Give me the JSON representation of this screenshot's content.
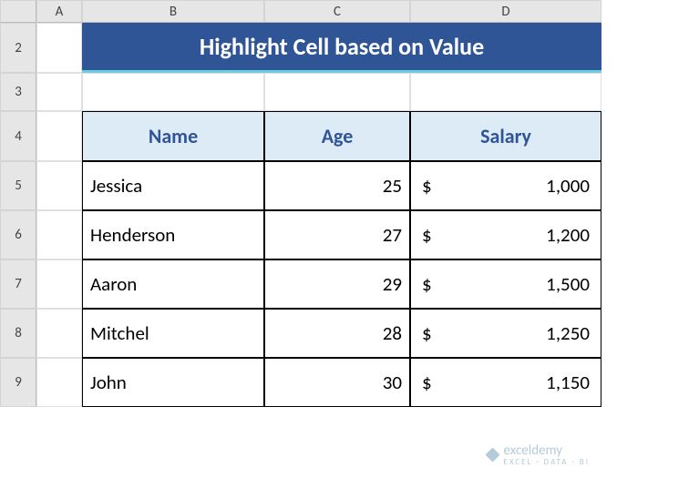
{
  "columns": [
    "A",
    "B",
    "C",
    "D"
  ],
  "rows": [
    "2",
    "3",
    "4",
    "5",
    "6",
    "7",
    "8",
    "9"
  ],
  "title": "Highlight Cell based on Value",
  "headers": {
    "name": "Name",
    "age": "Age",
    "salary": "Salary"
  },
  "currency": "$",
  "data": [
    {
      "name": "Jessica",
      "age": "25",
      "salary": "1,000"
    },
    {
      "name": "Henderson",
      "age": "27",
      "salary": "1,200"
    },
    {
      "name": "Aaron",
      "age": "29",
      "salary": "1,500"
    },
    {
      "name": "Mitchel",
      "age": "28",
      "salary": "1,250"
    },
    {
      "name": "John",
      "age": "30",
      "salary": "1,150"
    }
  ],
  "watermark": {
    "brand": "exceldemy",
    "tagline": "EXCEL · DATA · BI"
  }
}
